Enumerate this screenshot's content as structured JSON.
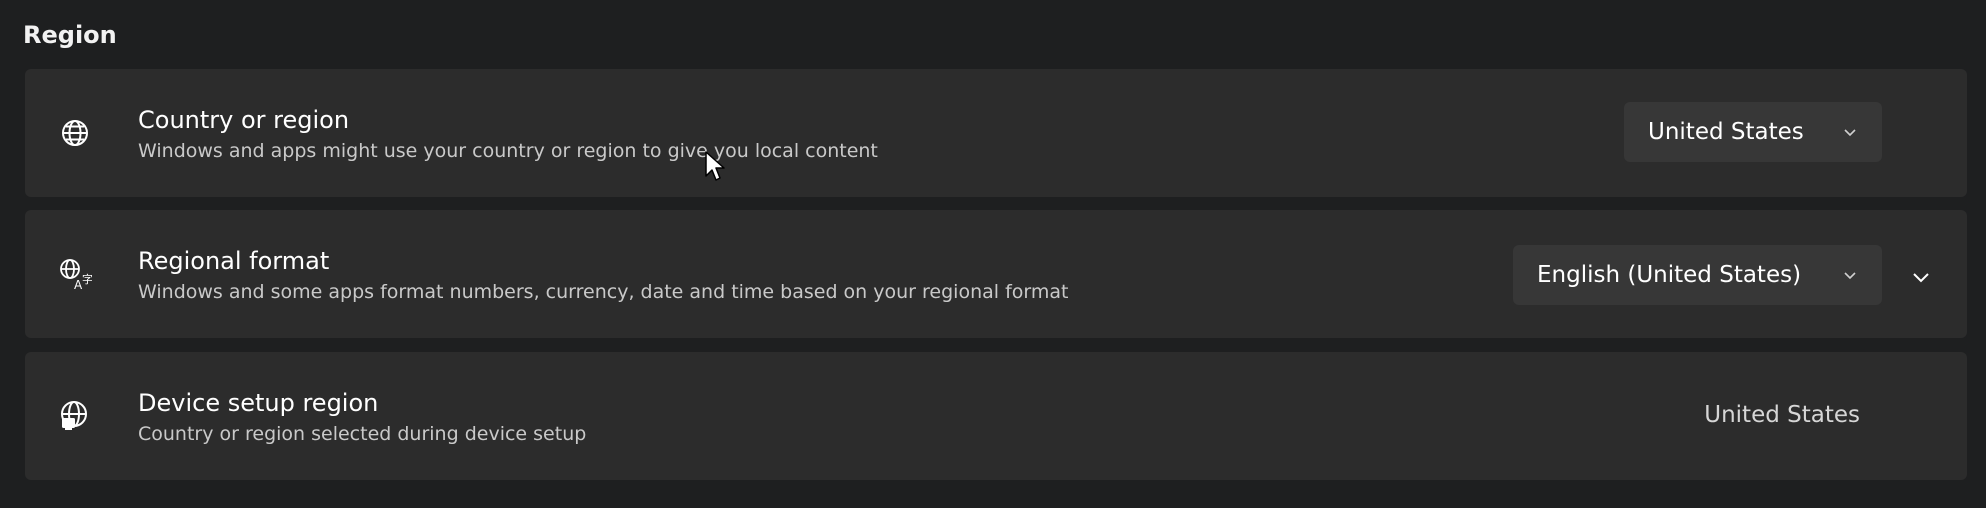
{
  "section": {
    "title": "Region"
  },
  "cards": {
    "country": {
      "icon": "globe-icon",
      "title": "Country or region",
      "description": "Windows and apps might use your country or region to give you local content",
      "selected_value": "United States"
    },
    "regional_format": {
      "icon": "language-format-icon",
      "title": "Regional format",
      "description": "Windows and some apps format numbers, currency, date and time based on your regional format",
      "selected_value": "English (United States)"
    },
    "device_setup": {
      "icon": "globe-device-icon",
      "title": "Device setup region",
      "description": "Country or region selected during device setup",
      "value": "United States"
    }
  },
  "colors": {
    "background": "#1e1f20",
    "card": "#2c2c2c",
    "dropdown": "#373737",
    "text_primary": "#ffffff",
    "text_secondary": "#c9c9c9"
  }
}
